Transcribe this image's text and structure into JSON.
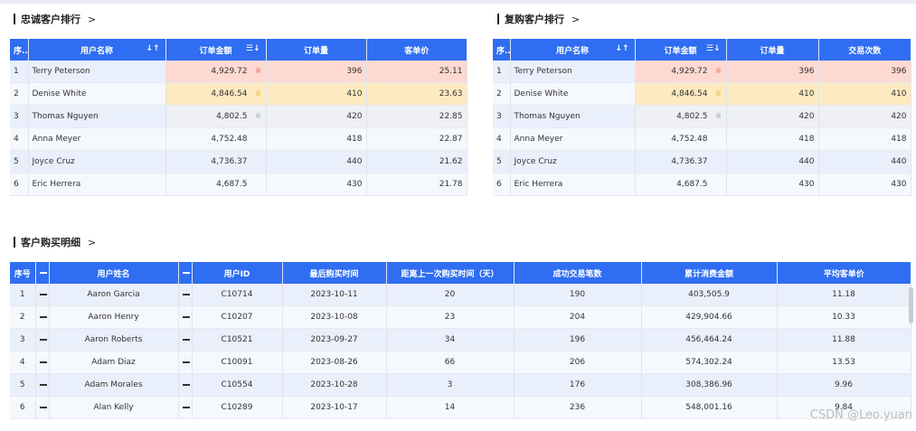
{
  "loyal": {
    "title": "忠诚客户排行",
    "arrow": ">",
    "headers": [
      "序..",
      "用户名称",
      "订单金额",
      "订单量",
      "客单价"
    ],
    "rows": [
      {
        "idx": "1",
        "name": "Terry Peterson",
        "amount": "4,929.72",
        "orders": "396",
        "price": "25.11"
      },
      {
        "idx": "2",
        "name": "Denise White",
        "amount": "4,846.54",
        "orders": "410",
        "price": "23.63"
      },
      {
        "idx": "3",
        "name": "Thomas Nguyen",
        "amount": "4,802.5",
        "orders": "420",
        "price": "22.85"
      },
      {
        "idx": "4",
        "name": "Anna Meyer",
        "amount": "4,752.48",
        "orders": "418",
        "price": "22.87"
      },
      {
        "idx": "5",
        "name": "Joyce Cruz",
        "amount": "4,736.37",
        "orders": "440",
        "price": "21.62"
      },
      {
        "idx": "6",
        "name": "Eric Herrera",
        "amount": "4,687.5",
        "orders": "430",
        "price": "21.78"
      }
    ]
  },
  "repeat": {
    "title": "复购客户排行",
    "arrow": ">",
    "headers": [
      "序..",
      "用户名称",
      "订单金额",
      "订单量",
      "交易次数"
    ],
    "rows": [
      {
        "idx": "1",
        "name": "Terry Peterson",
        "amount": "4,929.72",
        "orders": "396",
        "trades": "396"
      },
      {
        "idx": "2",
        "name": "Denise White",
        "amount": "4,846.54",
        "orders": "410",
        "trades": "410"
      },
      {
        "idx": "3",
        "name": "Thomas Nguyen",
        "amount": "4,802.5",
        "orders": "420",
        "trades": "420"
      },
      {
        "idx": "4",
        "name": "Anna Meyer",
        "amount": "4,752.48",
        "orders": "418",
        "trades": "418"
      },
      {
        "idx": "5",
        "name": "Joyce Cruz",
        "amount": "4,736.37",
        "orders": "440",
        "trades": "440"
      },
      {
        "idx": "6",
        "name": "Eric Herrera",
        "amount": "4,687.5",
        "orders": "430",
        "trades": "430"
      }
    ]
  },
  "detail": {
    "title": "客户购买明细",
    "arrow": ">",
    "headers": [
      "序号",
      "用户姓名",
      "用户ID",
      "最后购买时间",
      "距离上一次购买时间（天）",
      "成功交易笔数",
      "累计消费金额",
      "平均客单价"
    ],
    "rows": [
      {
        "idx": "1",
        "name": "Aaron Garcia",
        "uid": "C10714",
        "last": "2023-10-11",
        "days": "20",
        "count": "190",
        "total": "403,505.9",
        "avg": "11.18"
      },
      {
        "idx": "2",
        "name": "Aaron Henry",
        "uid": "C10207",
        "last": "2023-10-08",
        "days": "23",
        "count": "204",
        "total": "429,904.66",
        "avg": "10.33"
      },
      {
        "idx": "3",
        "name": "Aaron Roberts",
        "uid": "C10521",
        "last": "2023-09-27",
        "days": "34",
        "count": "196",
        "total": "456,464.24",
        "avg": "11.88"
      },
      {
        "idx": "4",
        "name": "Adam Diaz",
        "uid": "C10091",
        "last": "2023-08-26",
        "days": "66",
        "count": "206",
        "total": "574,302.24",
        "avg": "13.53"
      },
      {
        "idx": "5",
        "name": "Adam Morales",
        "uid": "C10554",
        "last": "2023-10-28",
        "days": "3",
        "count": "176",
        "total": "308,386.96",
        "avg": "9.96"
      },
      {
        "idx": "6",
        "name": "Alan Kelly",
        "uid": "C10289",
        "last": "2023-10-17",
        "days": "14",
        "count": "236",
        "total": "548,001.16",
        "avg": "9.84"
      }
    ]
  },
  "icons": {
    "medal": "medal-icon",
    "sort": "sort-icon",
    "collapse": "collapse-icon"
  },
  "colors": {
    "header": "#2f6ef2",
    "rank1": "#fdd9d1",
    "rank2": "#fdeac0",
    "rank3": "#eef0f4",
    "row_odd": "#eaf0fb",
    "row_even": "#f5f8fd"
  },
  "watermark": "CSDN @Leo.yuan"
}
